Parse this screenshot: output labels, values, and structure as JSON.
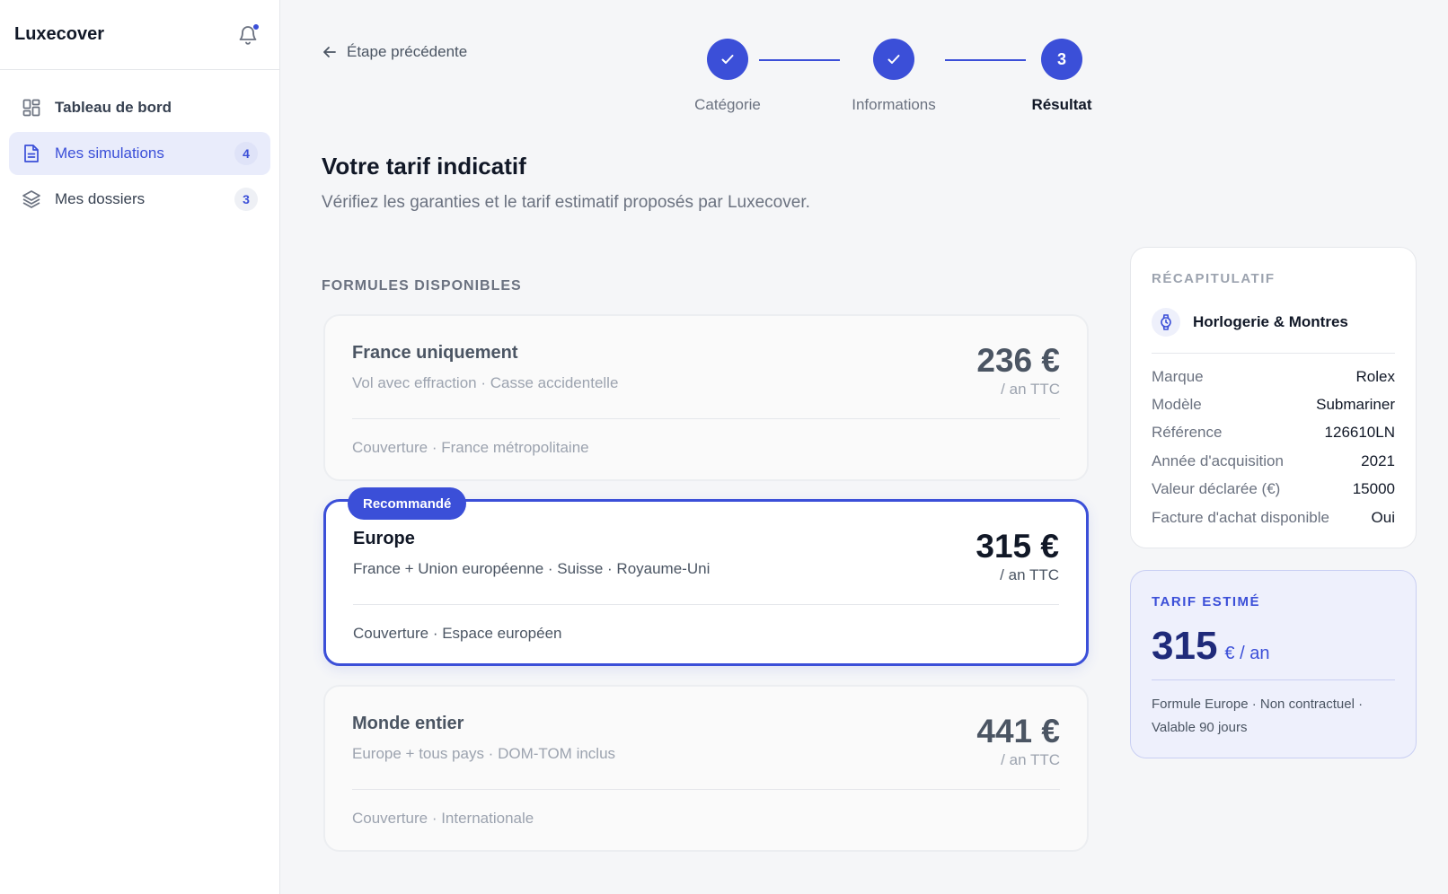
{
  "sidebar": {
    "brand": "Luxecover",
    "items": [
      {
        "label": "Tableau de bord",
        "icon": "grid-icon"
      },
      {
        "label": "Mes simulations",
        "icon": "document-icon",
        "count": "4"
      },
      {
        "label": "Mes dossiers",
        "icon": "layers-icon",
        "count": "3"
      }
    ]
  },
  "header": {
    "back_label": "Étape précédente",
    "steps": [
      {
        "label": "Catégorie",
        "state": "done"
      },
      {
        "label": "Informations",
        "state": "done"
      },
      {
        "label": "Résultat",
        "state": "current",
        "number": "3"
      }
    ]
  },
  "main": {
    "title": "Votre tarif indicatif",
    "subtitle": "Vérifiez les garanties et le tarif estimatif proposés par Luxecover.",
    "section_title": "FORMULES DISPONIBLES",
    "plans": [
      {
        "name": "France uniquement",
        "description": "Vol avec effraction · Casse accidentelle",
        "price": "236 €",
        "unit": "/ an TTC",
        "coverage": "Couverture · France métropolitaine"
      },
      {
        "name": "Europe",
        "description": "France + Union européenne · Suisse · Royaume-Uni",
        "price": "315 €",
        "unit": "/ an TTC",
        "coverage": "Couverture · Espace européen",
        "badge": "Recommandé"
      },
      {
        "name": "Monde entier",
        "description": "Europe + tous pays · DOM-TOM inclus",
        "price": "441 €",
        "unit": "/ an TTC",
        "coverage": "Couverture · Internationale"
      }
    ]
  },
  "summary": {
    "kicker": "RÉCAPITULATIF",
    "category": "Horlogerie & Montres",
    "rows": [
      {
        "key": "Marque",
        "value": "Rolex"
      },
      {
        "key": "Modèle",
        "value": "Submariner"
      },
      {
        "key": "Référence",
        "value": "126610LN"
      },
      {
        "key": "Année d'acquisition",
        "value": "2021"
      },
      {
        "key": "Valeur déclarée (€)",
        "value": "15000"
      },
      {
        "key": "Facture d'achat disponible",
        "value": "Oui"
      }
    ]
  },
  "estimate": {
    "kicker": "TARIF ESTIMÉ",
    "value": "315",
    "unit": "€ / an",
    "note": "Formule Europe · Non contractuel · Valable 90 jours"
  },
  "colors": {
    "accent": "#3b4fd8",
    "accent_dark": "#1f2a7a",
    "accent_light": "#eef0fc"
  }
}
